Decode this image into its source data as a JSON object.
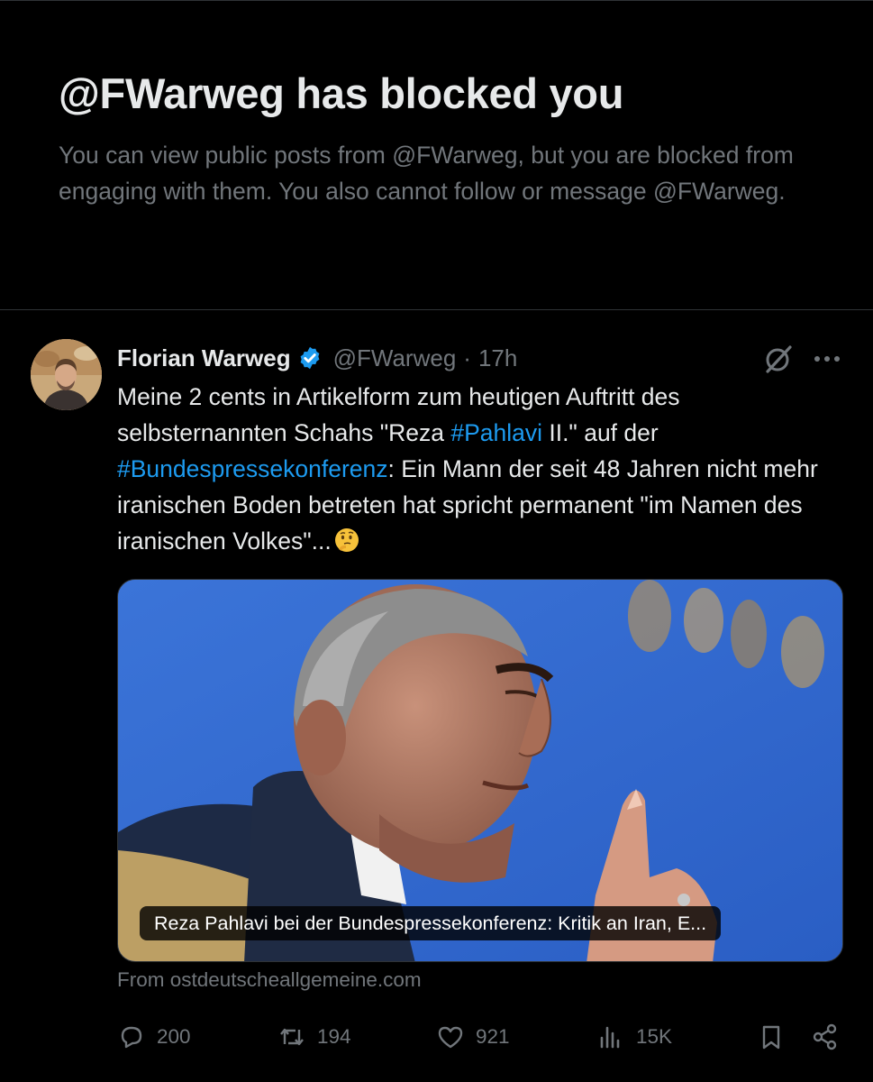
{
  "blocked_notice": {
    "title": "@FWarweg has blocked you",
    "description": "You can view public posts from @FWarweg, but you are blocked from engaging with them. You also cannot follow or message @FWarweg."
  },
  "tweet": {
    "author_name": "Florian Warweg",
    "handle": "@FWarweg",
    "separator": "·",
    "time": "17h",
    "text": {
      "part1": "Meine 2 cents in Artikelform zum heutigen Auftritt des selbsternannten Schahs \"Reza ",
      "hashtag1": "#Pahlavi",
      "part2": " II.\" auf der ",
      "hashtag2": "#Bundespressekonferenz",
      "part3": ": Ein Mann der seit 48 Jahren nicht mehr iranischen Boden betreten hat spricht permanent \"im Namen des iranischen Volkes\"..."
    },
    "media": {
      "caption": "Reza Pahlavi bei der Bundespressekonferenz: Kritik an Iran, E..."
    },
    "source": "From ostdeutscheallgemeine.com",
    "stats": {
      "replies": "200",
      "reposts": "194",
      "likes": "921",
      "views": "15K"
    }
  },
  "colors": {
    "background": "#000000",
    "text_primary": "#e7e9ea",
    "text_secondary": "#71767b",
    "link": "#1d9bf0",
    "verified": "#1d9bf0",
    "border": "#2f3336"
  },
  "icons": [
    "verified-badge-icon",
    "grok-icon",
    "more-icon",
    "thinking-face-emoji",
    "reply-icon",
    "repost-icon",
    "like-icon",
    "views-icon",
    "bookmark-icon",
    "share-icon"
  ]
}
